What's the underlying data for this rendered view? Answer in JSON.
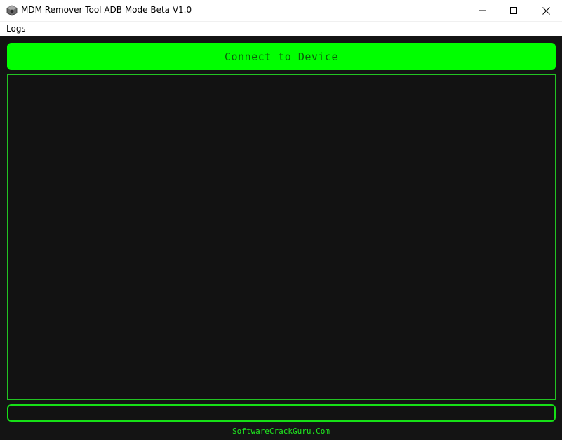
{
  "window": {
    "title": "MDM Remover Tool ADB Mode Beta V1.0",
    "app_icon": "gear-box-icon",
    "controls": {
      "minimize": "minimize-icon",
      "maximize": "maximize-icon",
      "close": "close-icon"
    }
  },
  "menu": {
    "items": [
      {
        "label": "Logs"
      }
    ]
  },
  "main": {
    "connect_button_label": "Connect to Device",
    "log_text": "",
    "input_value": "",
    "footer_link": "SoftwareCrackGuru.Com"
  },
  "colors": {
    "accent_green": "#00ff00",
    "background": "#141414",
    "border_green": "#22c322",
    "button_text": "#0b5d0b"
  }
}
